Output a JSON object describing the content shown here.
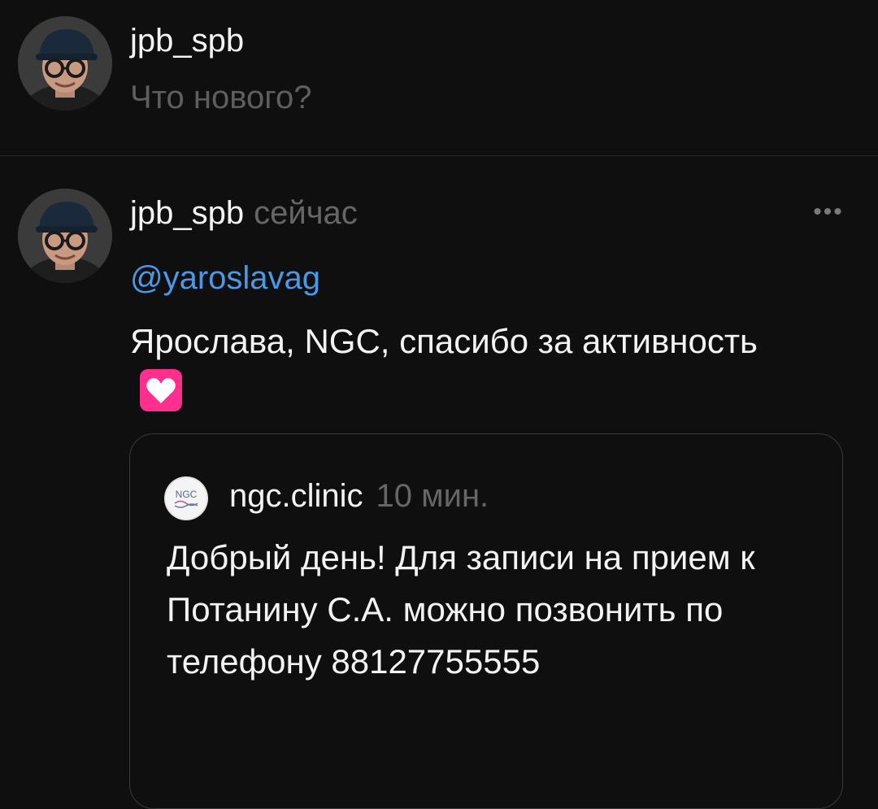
{
  "composer": {
    "username": "jpb_spb",
    "placeholder": "Что нового?"
  },
  "post": {
    "author": "jpb_spb",
    "time": "сейчас",
    "mention": "@yaroslavag",
    "text": "Ярослава, NGC, спасибо за активность",
    "emoji": "heart-emoji",
    "quote": {
      "author": "ngc.clinic",
      "time": "10 мин.",
      "text": "Добрый день! Для записи на прием к Потанину С.А. можно позвонить по телефону 88127755555",
      "avatar_logo": "NGC"
    }
  },
  "colors": {
    "background": "#0f0f0f",
    "mention": "#4a98e6",
    "secondary_text": "#666666",
    "emoji_pink": "#ff2f8e"
  }
}
